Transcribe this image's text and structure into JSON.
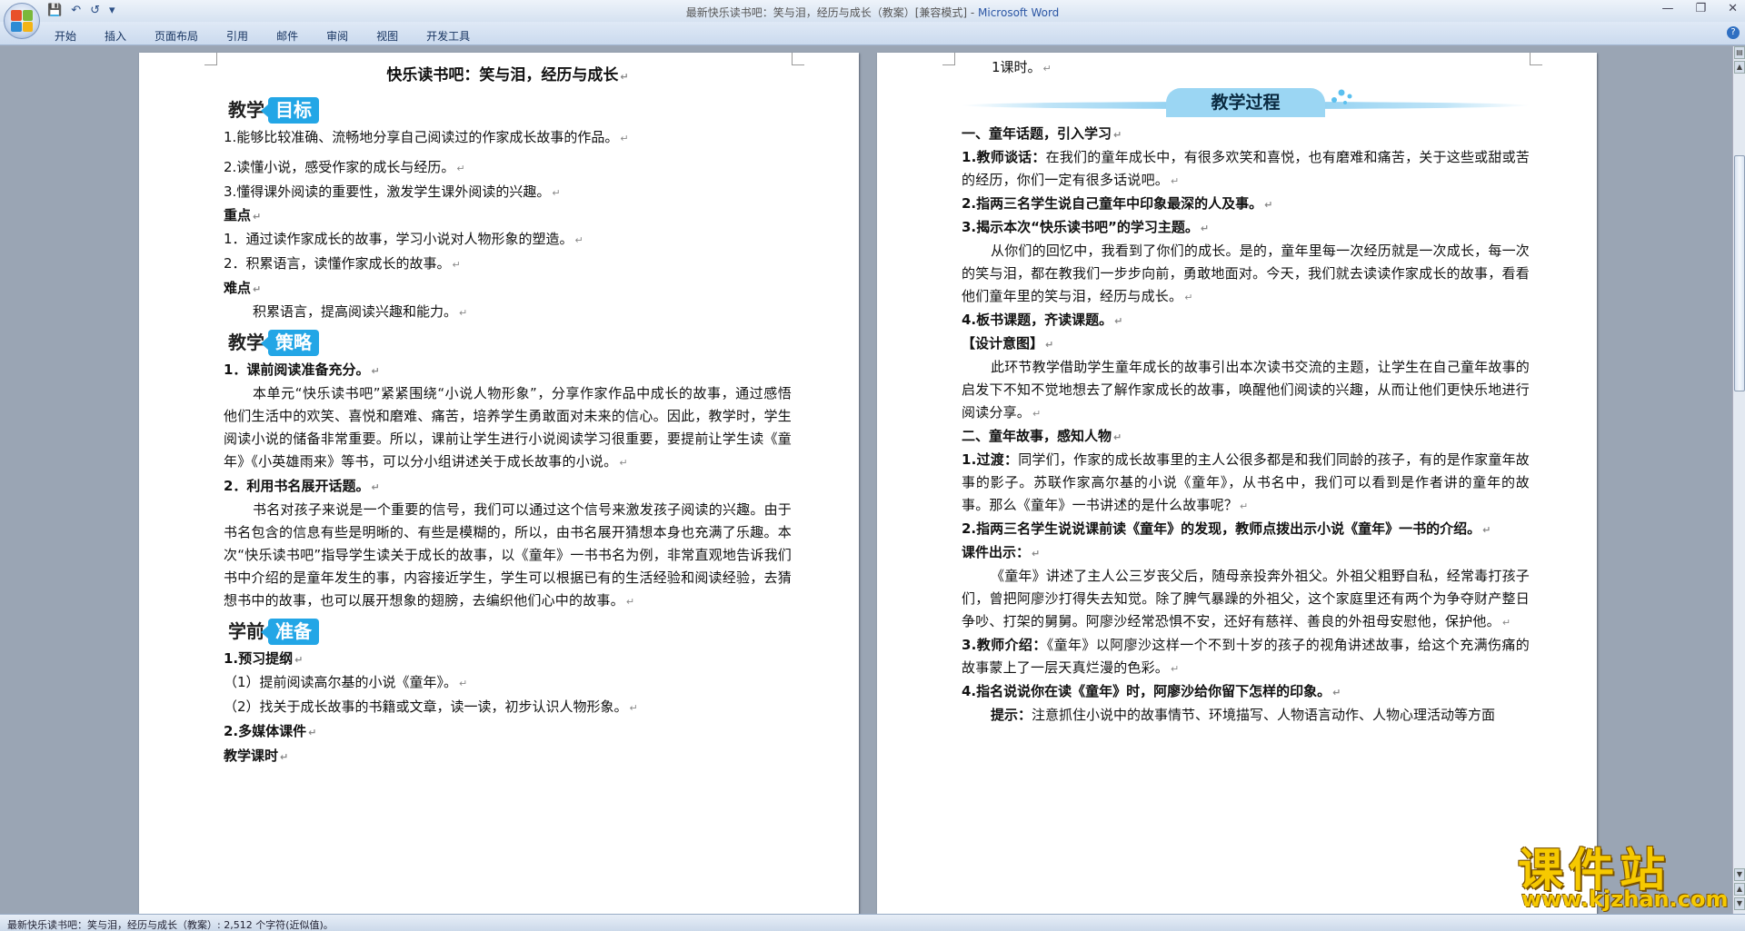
{
  "window": {
    "title": "最新快乐读书吧：笑与泪，经历与成长（教案）[兼容模式] - ",
    "app_name": "Microsoft Word"
  },
  "ribbon": {
    "tabs": [
      "开始",
      "插入",
      "页面布局",
      "引用",
      "邮件",
      "审阅",
      "视图",
      "开发工具"
    ]
  },
  "left_page": {
    "doc_title": "快乐读书吧：笑与泪，经历与成长",
    "heading_goals": {
      "black": "教学",
      "blue": "目标"
    },
    "goals": [
      "1.能够比较准确、流畅地分享自己阅读过的作家成长故事的作品。",
      "2.读懂小说，感受作家的成长与经历。",
      "3.懂得课外阅读的重要性，激发学生课外阅读的兴趣。"
    ],
    "key_label": "重点",
    "key_points": [
      "1．通过读作家成长的故事，学习小说对人物形象的塑造。",
      "2．积累语言，读懂作家成长的故事。"
    ],
    "difficulty_label": "难点",
    "difficulty": "积累语言，提高阅读兴趣和能力。",
    "heading_strategy": {
      "black": "教学",
      "blue": "策略"
    },
    "strategy1_title": "1．课前阅读准备充分。",
    "strategy1_text": "本单元“快乐读书吧”紧紧围绕“小说人物形象”，分享作家作品中成长的故事，通过感悟他们生活中的欢笑、喜悦和磨难、痛苦，培养学生勇敢面对未来的信心。因此，教学时，学生阅读小说的储备非常重要。所以，课前让学生进行小说阅读学习很重要，要提前让学生读《童年》《小英雄雨来》等书，可以分小组讲述关于成长故事的小说。",
    "strategy2_title": "2．利用书名展开话题。",
    "strategy2_text": "书名对孩子来说是一个重要的信号，我们可以通过这个信号来激发孩子阅读的兴趣。由于书名包含的信息有些是明晰的、有些是模糊的，所以，由书名展开猜想本身也充满了乐趣。本次“快乐读书吧”指导学生读关于成长的故事，以《童年》一书书名为例，非常直观地告诉我们书中介绍的是童年发生的事，内容接近学生，学生可以根据已有的生活经验和阅读经验，去猜想书中的故事，也可以展开想象的翅膀，去编织他们心中的故事。",
    "heading_prep": {
      "black": "学前",
      "blue": "准备"
    },
    "prep1_title": "1.预习提纲",
    "prep1_items": [
      "（1）提前阅读高尔基的小说《童年》。",
      "（2）找关于成长故事的书籍或文章，读一读，初步认识人物形象。"
    ],
    "prep2_title": "2.多媒体课件",
    "prep3_title": "教学课时"
  },
  "right_page": {
    "carry_over": "1课时。",
    "banner": "教学过程",
    "sec1_title": "一、童年话题，引入学习",
    "s1_item1_label": "1.教师谈话：",
    "s1_item1_text": "在我们的童年成长中，有很多欢笑和喜悦，也有磨难和痛苦，关于这些或甜或苦的经历，你们一定有很多话说吧。",
    "s1_item2": "2.指两三名学生说自己童年中印象最深的人及事。",
    "s1_item3": "3.揭示本次“快乐读书吧”的学习主题。",
    "s1_para": "从你们的回忆中，我看到了你们的成长。是的，童年里每一次经历就是一次成长，每一次的笑与泪，都在教我们一步步向前，勇敢地面对。今天，我们就去读读作家成长的故事，看看他们童年里的笑与泪，经历与成长。",
    "s1_item4": "4.板书课题，齐读课题。",
    "design_label": "【设计意图】",
    "design_text": "此环节教学借助学生童年成长的故事引出本次读书交流的主题，让学生在自己童年故事的启发下不知不觉地想去了解作家成长的故事，唤醒他们阅读的兴趣，从而让他们更快乐地进行阅读分享。",
    "sec2_title": "二、童年故事，感知人物",
    "s2_item1_label": "1.过渡：",
    "s2_item1_text": "同学们，作家的成长故事里的主人公很多都是和我们同龄的孩子，有的是作家童年故事的影子。苏联作家高尔基的小说《童年》，从书名中，我们可以看到是作者讲的童年的故事。那么《童年》一书讲述的是什么故事呢？",
    "s2_item2": "2.指两三名学生说说课前读《童年》的发现，教师点拨出示小说《童年》一书的介绍。",
    "courseware_label": "课件出示：",
    "courseware_text": "《童年》讲述了主人公三岁丧父后，随母亲投奔外祖父。外祖父粗野自私，经常毒打孩子们，曾把阿廖沙打得失去知觉。除了脾气暴躁的外祖父，这个家庭里还有两个为争夺财产整日争吵、打架的舅舅。阿廖沙经常恐惧不安，还好有慈祥、善良的外祖母安慰他，保护他。",
    "s2_item3_label": "3.教师介绍：",
    "s2_item3_text": "《童年》以阿廖沙这样一个不到十岁的孩子的视角讲述故事，给这个充满伤痛的故事蒙上了一层天真烂漫的色彩。",
    "s2_item4": "4.指名说说你在读《童年》时，阿廖沙给你留下怎样的印象。",
    "hint_label": "提示：",
    "hint_text": "注意抓住小说中的故事情节、环境描写、人物语言动作、人物心理活动等方面"
  },
  "status": {
    "text": "最新快乐读书吧：笑与泪，经历与成长（教案）: 2,512 个字符(近似值)。"
  },
  "watermark": {
    "main": "课件站",
    "sub": "www.kjzhan.com"
  },
  "colors": {
    "heading_blue": "#23a6e6",
    "banner_blue": "#9bd6f3",
    "watermark_yellow": "#f6c900"
  }
}
